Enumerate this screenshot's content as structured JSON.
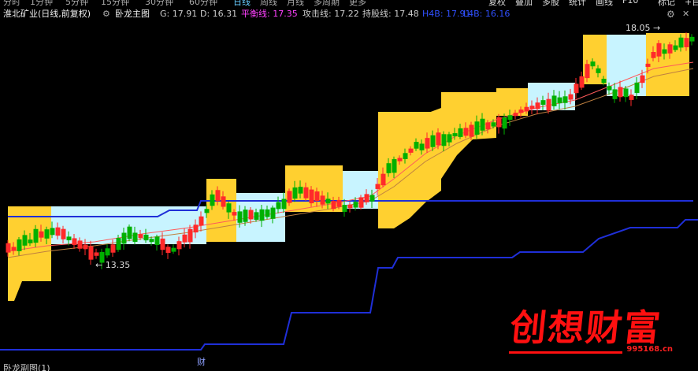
{
  "top_tabs": [
    {
      "label": "分时",
      "active": false
    },
    {
      "label": "1分钟",
      "active": false
    },
    {
      "label": "5分钟",
      "active": false
    },
    {
      "label": "15分钟",
      "active": false
    },
    {
      "label": "30分钟",
      "active": false
    },
    {
      "label": "60分钟",
      "active": false
    },
    {
      "label": "日线",
      "active": true
    },
    {
      "label": "周线",
      "active": false
    },
    {
      "label": "月线",
      "active": false
    },
    {
      "label": "多周期",
      "active": false
    },
    {
      "label": "更多",
      "active": false
    }
  ],
  "top_right_buttons": [
    "复权",
    "叠加",
    "多股",
    "统计",
    "画线",
    "F10",
    "标记",
    "+自选"
  ],
  "info": {
    "stock": "淮北矿业(日线,前复权)",
    "indicator": "卧龙主图",
    "g": "G: 17.91",
    "d": "D: 16.31",
    "balance": "平衡线: 17.35",
    "offensive": "攻击线: 17.22",
    "holding": "持股线: 17.48",
    "h4b": "H4B: 17.91",
    "l4b": "L4B: 16.16"
  },
  "colors": {
    "up": "#ff2a2a",
    "down": "#00b000",
    "cloud_yellow": "#ffd030",
    "cloud_cyan": "#c8f4ff",
    "blue_line": "#1f2fd8",
    "balance": "#ff40ff",
    "info_blue": "#3050ff"
  },
  "annotations": {
    "high": "18.05",
    "low": "13.35"
  },
  "bottom": {
    "caption": "财"
  },
  "watermark": {
    "text": "创想财富",
    "url": "995168.cn"
  }
}
